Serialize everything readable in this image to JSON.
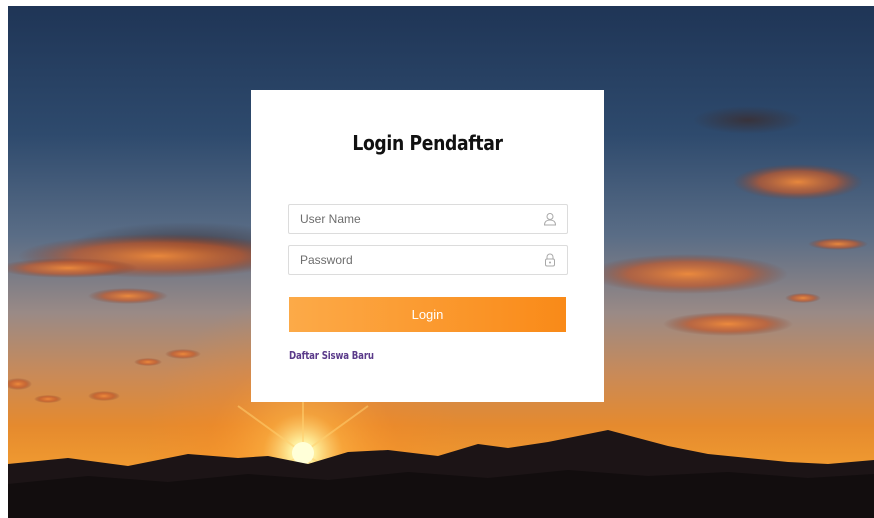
{
  "login_card": {
    "title": "Login Pendaftar",
    "username_placeholder": "User Name",
    "username_value": "",
    "password_placeholder": "Password",
    "password_value": "",
    "login_label": "Login",
    "register_link_label": "Daftar Siswa Baru",
    "icons": {
      "username": "user-icon",
      "password": "lock-icon"
    }
  },
  "colors": {
    "button_gradient_start": "#fcaa48",
    "button_gradient_end": "#f98a18",
    "link": "#5a3a8a",
    "card_background": "#ffffff"
  }
}
